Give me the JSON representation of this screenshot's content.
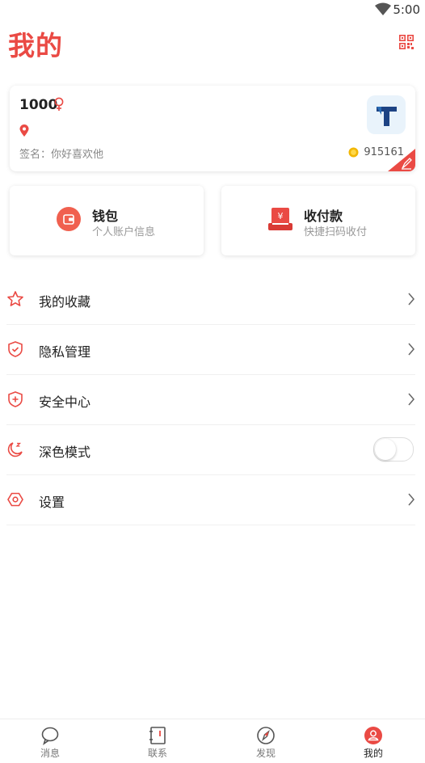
{
  "status_bar": {
    "time": "5:00"
  },
  "header": {
    "title": "我的"
  },
  "profile": {
    "name": "1000",
    "signature": "签名：你好喜欢他",
    "coins": "915161"
  },
  "quick_actions": [
    {
      "title": "钱包",
      "subtitle": "个人账户信息"
    },
    {
      "title": "收付款",
      "subtitle": "快捷扫码收付"
    }
  ],
  "menu": {
    "items": [
      {
        "label": "我的收藏"
      },
      {
        "label": "隐私管理"
      },
      {
        "label": "安全中心"
      },
      {
        "label": "深色模式",
        "toggle_on": false
      },
      {
        "label": "设置"
      }
    ]
  },
  "tabs": [
    {
      "label": "消息"
    },
    {
      "label": "联系"
    },
    {
      "label": "发现"
    },
    {
      "label": "我的",
      "active": true
    }
  ],
  "colors": {
    "accent": "#ea4a44"
  }
}
